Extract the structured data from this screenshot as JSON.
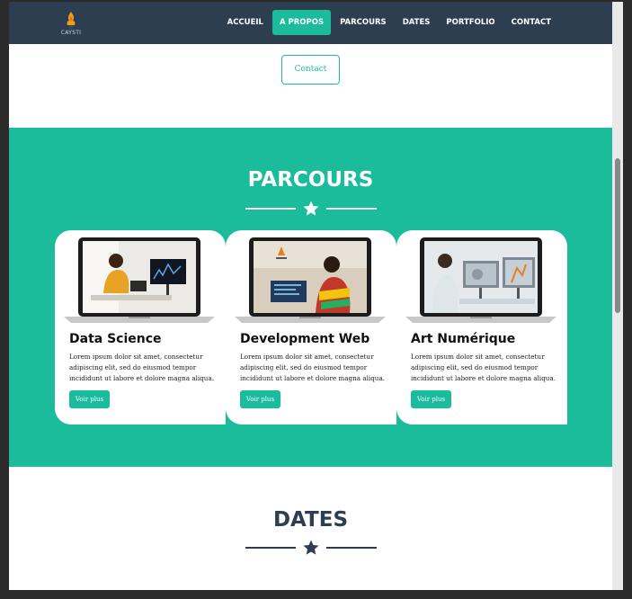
{
  "brand": {
    "logo_text": "CAYSTI"
  },
  "nav": {
    "items": [
      {
        "label": "ACCUEIL",
        "active": false
      },
      {
        "label": "A PROPOS",
        "active": true
      },
      {
        "label": "PARCOURS",
        "active": false
      },
      {
        "label": "DATES",
        "active": false
      },
      {
        "label": "PORTFOLIO",
        "active": false
      },
      {
        "label": "CONTACT",
        "active": false
      }
    ]
  },
  "contact_button": {
    "label": "Contact"
  },
  "parcours": {
    "title": "PARCOURS",
    "cards": [
      {
        "title": "Data Science",
        "text": "Lorem ipsum dolor sit amet, consectetur adipiscing elit, sed do eiusmod tempor incididunt ut labore et dolore magna aliqua.",
        "button": "Voir plus"
      },
      {
        "title": "Development Web",
        "text": "Lorem ipsum dolor sit amet, consectetur adipiscing elit, sed do eiusmod tempor incididunt ut labore et dolore magna aliqua.",
        "button": "Voir plus"
      },
      {
        "title": "Art Numérique",
        "text": "Lorem ipsum dolor sit amet, consectetur adipiscing elit, sed do eiusmod tempor incididunt ut labore et dolore magna aliqua.",
        "button": "Voir plus"
      }
    ]
  },
  "dates": {
    "title": "DATES"
  },
  "icons": {
    "divider": "star-icon",
    "cards": [
      "laptop-data-science-icon",
      "laptop-web-dev-icon",
      "laptop-art-icon"
    ]
  },
  "colors": {
    "navbar": "#2c3e50",
    "accent": "#1abc9c",
    "white": "#ffffff"
  }
}
